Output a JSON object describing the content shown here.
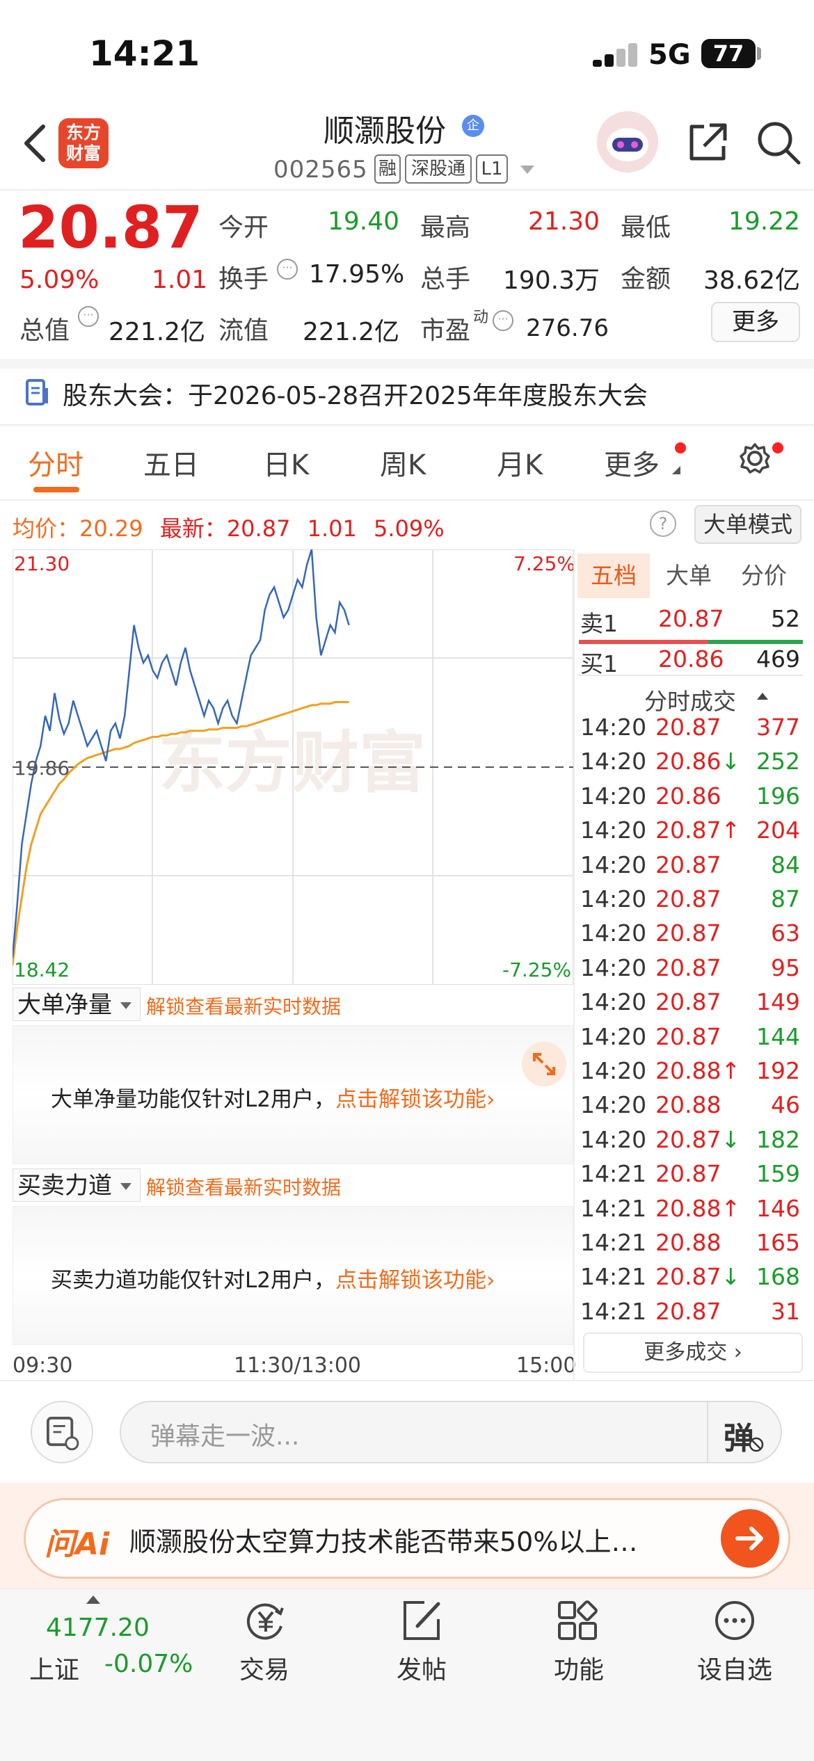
{
  "status_bar": {
    "time": "14:21",
    "network": "5G",
    "battery": "77"
  },
  "header": {
    "logo_line1": "东方",
    "logo_line2": "财富",
    "stock_name": "顺灏股份",
    "enterprise_badge": "企",
    "stock_code": "002565",
    "tags": [
      "融",
      "深股通",
      "L1"
    ]
  },
  "quote": {
    "price": "20.87",
    "change_pct": "5.09%",
    "change_amt": "1.01",
    "market_cap_label": "总值",
    "market_cap_value": "221.2亿",
    "fields": {
      "open_label": "今开",
      "open_value": "19.40",
      "high_label": "最高",
      "high_value": "21.30",
      "low_label": "最低",
      "low_value": "19.22",
      "turnover_label": "换手",
      "turnover_value": "17.95%",
      "volume_label": "总手",
      "volume_value": "190.3万",
      "amount_label": "金额",
      "amount_value": "38.62亿",
      "float_cap_label": "流值",
      "float_cap_value": "221.2亿",
      "pe_label": "市盈",
      "pe_sup": "动",
      "pe_value": "276.76"
    },
    "more_label": "更多"
  },
  "notice": {
    "text": "股东大会：于2026-05-28召开2025年年度股东大会"
  },
  "tabs": [
    "分时",
    "五日",
    "日K",
    "周K",
    "月K",
    "更多"
  ],
  "info_bar": {
    "avg_label": "均价：",
    "avg_value": "20.29",
    "latest_label": "最新：",
    "latest_value": "20.87",
    "latest_change": "1.01",
    "latest_pct": "5.09%",
    "help": "?",
    "big_order_mode": "大单模式"
  },
  "chart_data": {
    "type": "line",
    "y_max_label": "21.30",
    "y_max_pct": "7.25%",
    "y_min_label": "18.42",
    "y_min_pct": "-7.25%",
    "prev_close_label": "19.86",
    "ylim": [
      18.42,
      21.3
    ],
    "prev_close": 19.86,
    "watermark": "东方财富",
    "series": [
      {
        "name": "price",
        "color": "#3567b8",
        "values": [
          18.6,
          18.95,
          19.35,
          19.55,
          19.75,
          19.9,
          20.0,
          20.2,
          20.1,
          20.35,
          20.18,
          20.08,
          20.15,
          20.3,
          20.2,
          20.1,
          20.0,
          20.05,
          20.1,
          20.0,
          19.9,
          20.1,
          20.15,
          20.05,
          20.2,
          20.5,
          20.8,
          20.65,
          20.55,
          20.6,
          20.5,
          20.45,
          20.55,
          20.6,
          20.5,
          20.4,
          20.55,
          20.65,
          20.5,
          20.4,
          20.3,
          20.2,
          20.3,
          20.25,
          20.15,
          20.25,
          20.3,
          20.2,
          20.15,
          20.3,
          20.45,
          20.6,
          20.65,
          20.7,
          20.9,
          21.0,
          21.05,
          20.95,
          20.85,
          20.9,
          21.0,
          21.1,
          21.05,
          21.2,
          21.3,
          20.85,
          20.6,
          20.7,
          20.8,
          20.75,
          20.95,
          20.9,
          20.8
        ]
      },
      {
        "name": "avg",
        "color": "#f0a020",
        "values": [
          18.55,
          18.8,
          19.0,
          19.2,
          19.35,
          19.45,
          19.55,
          19.6,
          19.65,
          19.7,
          19.75,
          19.78,
          19.82,
          19.85,
          19.88,
          19.9,
          19.92,
          19.93,
          19.94,
          19.95,
          19.96,
          19.97,
          19.98,
          19.98,
          19.99,
          20.0,
          20.02,
          20.03,
          20.04,
          20.05,
          20.06,
          20.06,
          20.07,
          20.07,
          20.08,
          20.08,
          20.09,
          20.09,
          20.1,
          20.1,
          20.1,
          20.1,
          20.11,
          20.11,
          20.11,
          20.12,
          20.12,
          20.12,
          20.12,
          20.13,
          20.13,
          20.14,
          20.15,
          20.16,
          20.17,
          20.18,
          20.19,
          20.2,
          20.21,
          20.22,
          20.23,
          20.24,
          20.25,
          20.26,
          20.27,
          20.27,
          20.28,
          20.28,
          20.28,
          20.29,
          20.29,
          20.29,
          20.29
        ]
      }
    ]
  },
  "panels": {
    "net_flow": {
      "select": "大单净量",
      "hint": "解锁查看最新实时数据",
      "text": "大单净量功能仅针对L2用户，",
      "unlock": "点击解锁该功能",
      "arrow": "›"
    },
    "force": {
      "select": "买卖力道",
      "hint": "解锁查看最新实时数据",
      "text": "买卖力道功能仅针对L2用户，",
      "unlock": "点击解锁该功能",
      "arrow": "›"
    }
  },
  "time_axis": {
    "start": "09:30",
    "mid": "11:30/13:00",
    "end": "15:00"
  },
  "order_book": {
    "tabs": [
      "五档",
      "大单",
      "分价"
    ],
    "sell1": {
      "label": "卖1",
      "price": "20.87",
      "volume": "52"
    },
    "buy1": {
      "label": "买1",
      "price": "20.86",
      "volume": "469"
    },
    "trades_header": "分时成交",
    "trades": [
      {
        "time": "14:20",
        "price": "20.87",
        "arrow": "",
        "volume": "377",
        "dir": "up"
      },
      {
        "time": "14:20",
        "price": "20.86",
        "arrow": "↓",
        "volume": "252",
        "dir": "down"
      },
      {
        "time": "14:20",
        "price": "20.86",
        "arrow": "",
        "volume": "196",
        "dir": "down"
      },
      {
        "time": "14:20",
        "price": "20.87",
        "arrow": "↑",
        "volume": "204",
        "dir": "up"
      },
      {
        "time": "14:20",
        "price": "20.87",
        "arrow": "",
        "volume": "84",
        "dir": "down"
      },
      {
        "time": "14:20",
        "price": "20.87",
        "arrow": "",
        "volume": "87",
        "dir": "down"
      },
      {
        "time": "14:20",
        "price": "20.87",
        "arrow": "",
        "volume": "63",
        "dir": "up"
      },
      {
        "time": "14:20",
        "price": "20.87",
        "arrow": "",
        "volume": "95",
        "dir": "up"
      },
      {
        "time": "14:20",
        "price": "20.87",
        "arrow": "",
        "volume": "149",
        "dir": "up"
      },
      {
        "time": "14:20",
        "price": "20.87",
        "arrow": "",
        "volume": "144",
        "dir": "down"
      },
      {
        "time": "14:20",
        "price": "20.88",
        "arrow": "↑",
        "volume": "192",
        "dir": "up"
      },
      {
        "time": "14:20",
        "price": "20.88",
        "arrow": "",
        "volume": "46",
        "dir": "up"
      },
      {
        "time": "14:20",
        "price": "20.87",
        "arrow": "↓",
        "volume": "182",
        "dir": "down"
      },
      {
        "time": "14:21",
        "price": "20.87",
        "arrow": "",
        "volume": "159",
        "dir": "down"
      },
      {
        "time": "14:21",
        "price": "20.88",
        "arrow": "↑",
        "volume": "146",
        "dir": "up"
      },
      {
        "time": "14:21",
        "price": "20.88",
        "arrow": "",
        "volume": "165",
        "dir": "up"
      },
      {
        "time": "14:21",
        "price": "20.87",
        "arrow": "↓",
        "volume": "168",
        "dir": "down"
      },
      {
        "time": "14:21",
        "price": "20.87",
        "arrow": "",
        "volume": "31",
        "dir": "up"
      }
    ],
    "more_trades": "更多成交 ›"
  },
  "comment_bar": {
    "placeholder": "弹幕走一波...",
    "danmu": "弹"
  },
  "ai_bar": {
    "logo": "问Ai",
    "question": "顺灏股份太空算力技术能否带来50%以上…"
  },
  "bottom_nav": {
    "index_value": "4177.20",
    "index_name": "上证",
    "index_change": "-0.07%",
    "items": [
      "交易",
      "发帖",
      "功能",
      "设自选"
    ]
  },
  "colors": {
    "up": "#e02020",
    "down": "#1a9b2b",
    "accent": "#f26b1d"
  }
}
